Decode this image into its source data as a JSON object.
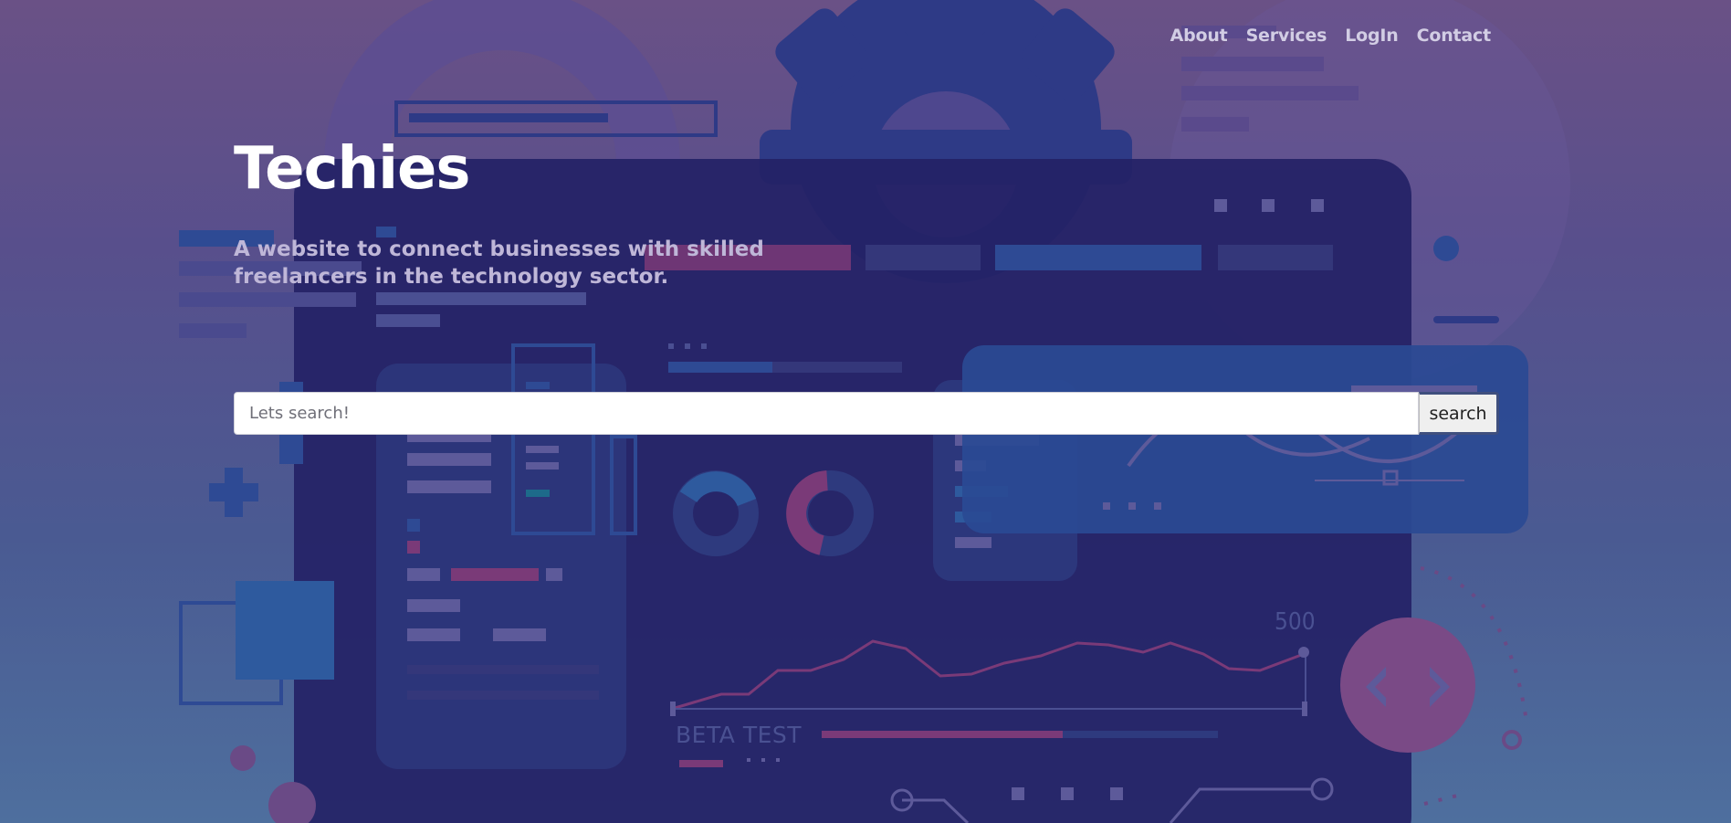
{
  "nav": {
    "items": [
      {
        "label": "About"
      },
      {
        "label": "Services"
      },
      {
        "label": "LogIn"
      },
      {
        "label": "Contact"
      }
    ]
  },
  "hero": {
    "title": "Techies",
    "subtitle": "A website to connect businesses with skilled freelancers in the technology sector."
  },
  "search": {
    "placeholder": "Lets search!",
    "value": "",
    "button_label": "search"
  },
  "illustration": {
    "chart_peak_label": "500",
    "chart_caption": "BETA TEST"
  },
  "colors": {
    "bg_top": "#6a5186",
    "bg_bottom": "#4e6f9e",
    "panel_dark": "#242266",
    "panel_blue": "#2a4a94",
    "accent_pink": "#8a4a86"
  }
}
